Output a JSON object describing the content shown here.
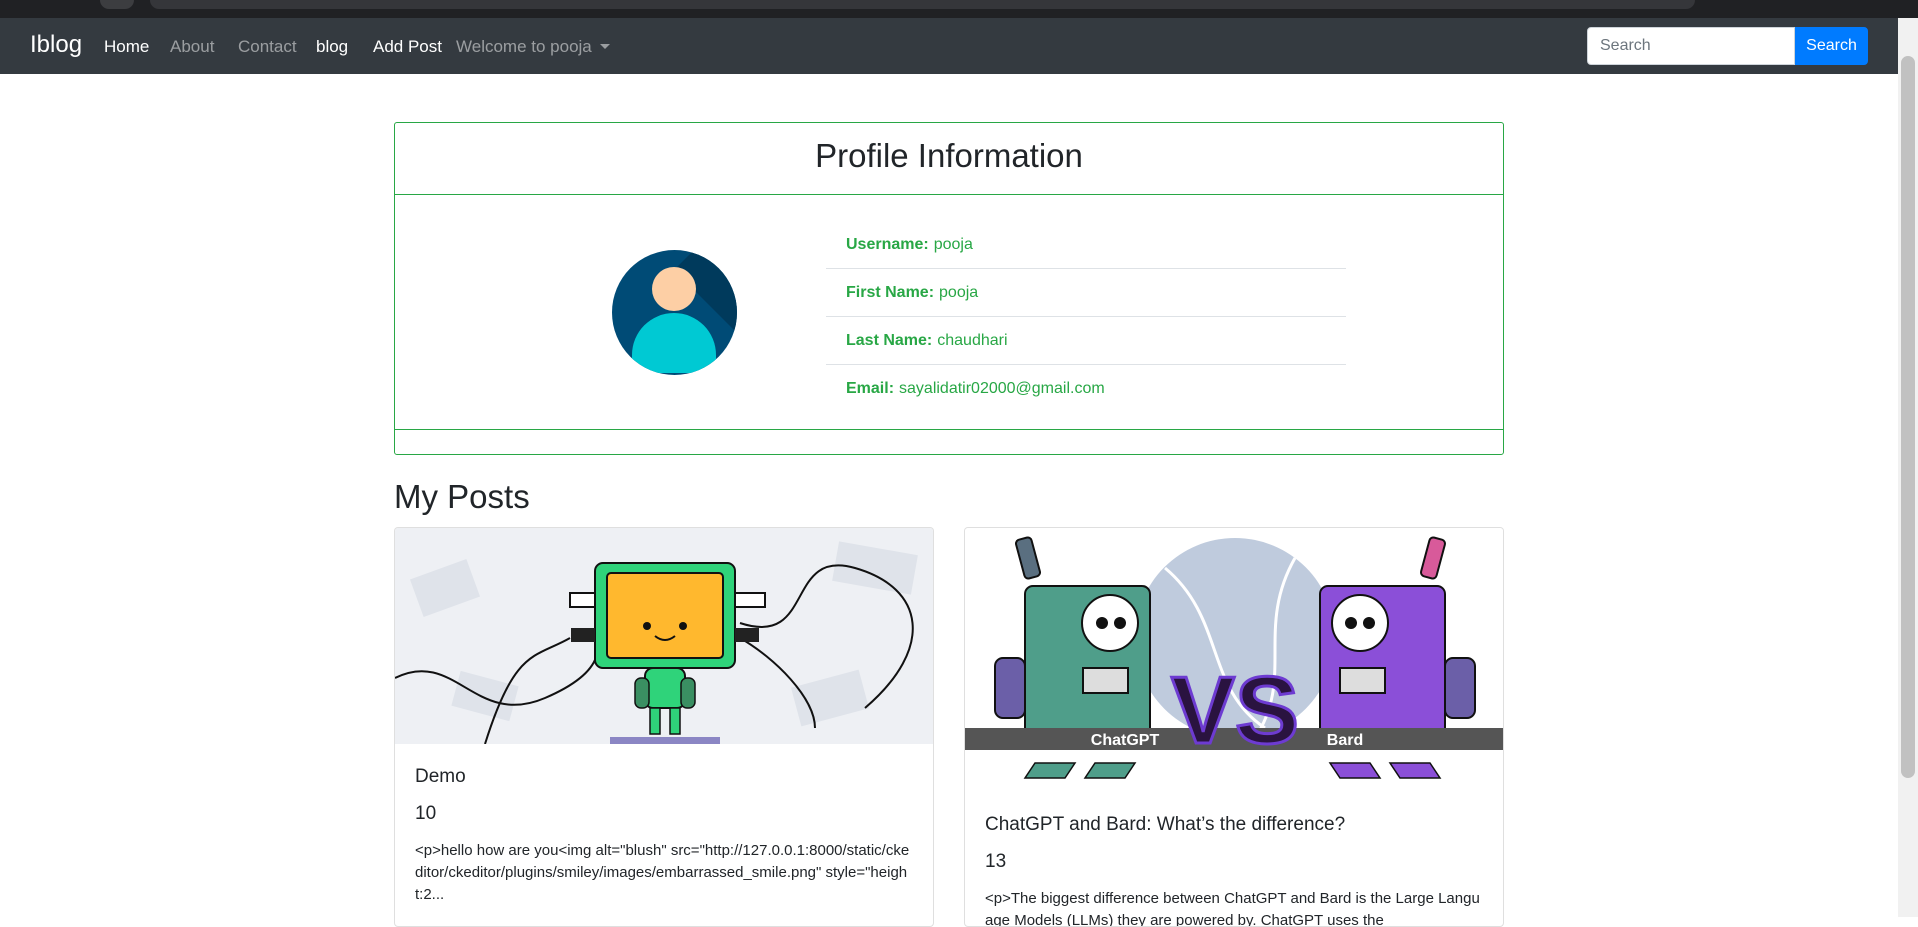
{
  "navbar": {
    "brand": "Iblog",
    "links": [
      "Home",
      "About",
      "Contact",
      "blog",
      "Add Post"
    ],
    "dropdown_label": "Welcome to pooja",
    "search_placeholder": "Search",
    "search_button": "Search"
  },
  "profile": {
    "title": "Profile Information",
    "fields": [
      {
        "label": "Username:",
        "value": "pooja"
      },
      {
        "label": "First Name:",
        "value": "pooja"
      },
      {
        "label": "Last Name:",
        "value": "chaudhari"
      },
      {
        "label": "Email:",
        "value": "sayalidatir02000@gmail.com"
      }
    ]
  },
  "posts": {
    "heading": "My Posts",
    "items": [
      {
        "title": "Demo",
        "number": "10",
        "excerpt": "<p>hello how are you<img alt=\"blush\" src=\"http://127.0.0.1:8000/static/ckeditor/ckeditor/plugins/smiley/images/embarrassed_smile.png\" style=\"height:2...",
        "image_icon": "robot-computer-illustration"
      },
      {
        "title": "ChatGPT and Bard: What’s the difference?",
        "number": "13",
        "excerpt": "<p>The biggest difference between ChatGPT and Bard is the Large Language Models (LLMs) they are powered by. ChatGPT uses the",
        "image_label_left": "ChatGPT",
        "image_label_vs": "VS",
        "image_label_right": "Bard",
        "image_icon": "chatgpt-vs-bard-robots-illustration"
      }
    ]
  },
  "colors": {
    "navbar_bg": "#343a40",
    "accent_green": "#28a745",
    "primary_blue": "#007bff"
  }
}
